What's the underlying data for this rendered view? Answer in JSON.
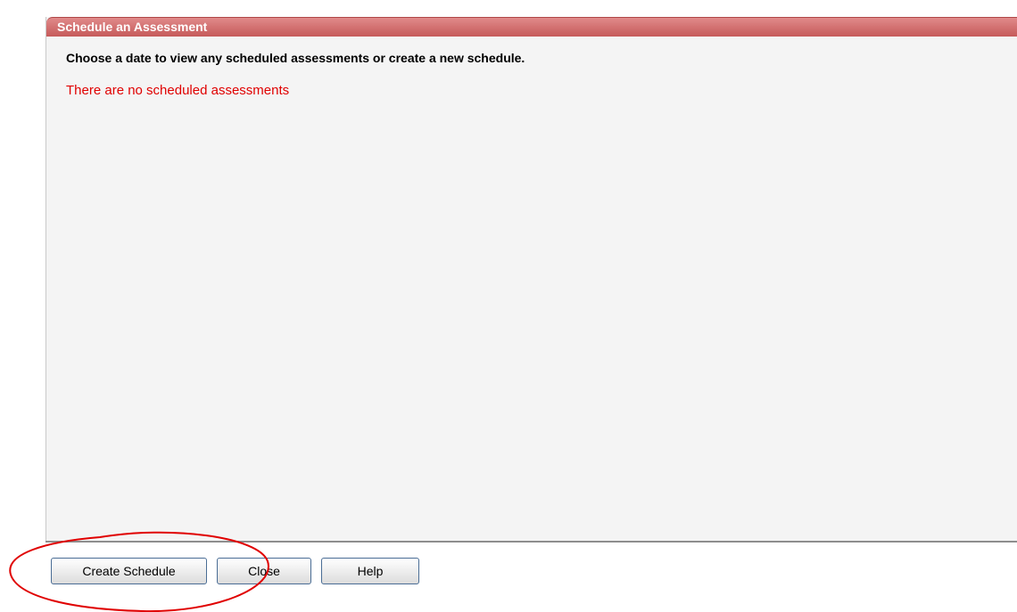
{
  "panel": {
    "title": "Schedule an Assessment",
    "instruction": "Choose a date to view any scheduled assessments or create a new schedule.",
    "empty_message": "There are no scheduled assessments"
  },
  "buttons": {
    "create_schedule": "Create Schedule",
    "close": "Close",
    "help": "Help"
  },
  "colors": {
    "header": "#c65a5a",
    "empty_message": "#e00000",
    "annotation": "#e00000"
  }
}
